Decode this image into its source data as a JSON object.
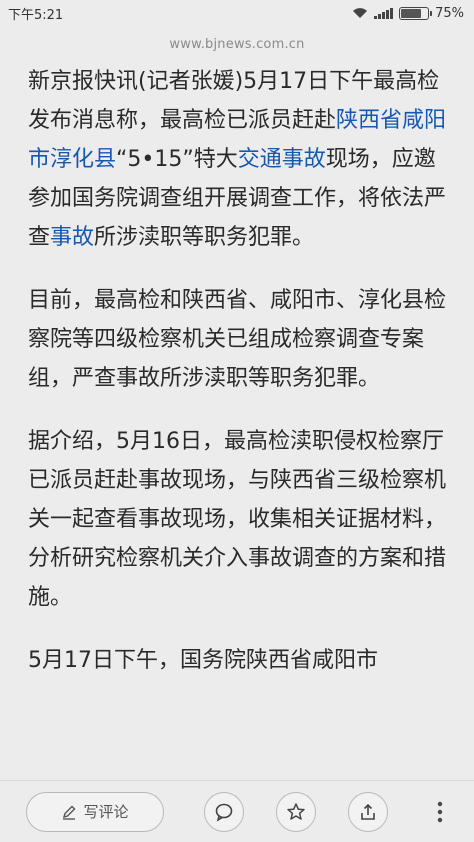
{
  "status_bar": {
    "time": "下午5:21",
    "battery": "75%",
    "battery_level": 0.75
  },
  "url_bar": {
    "url": "www.bjnews.com.cn"
  },
  "article": {
    "p1": {
      "t1": "新京报快讯(记者张媛)5月17日下午最高检发布消息称，最高检已派员赶赴",
      "link1": "陕西省咸阳市淳化县",
      "t2": "“5•15”特大",
      "link2": "交通事故",
      "t3": "现场，应邀参加国务院调查组开展调查工作，将依法严查",
      "link3": "事故",
      "t4": "所涉渎职等职务犯罪。"
    },
    "p2": "目前，最高检和陕西省、咸阳市、淳化县检察院等四级检察机关已组成检察调查专案组，严查事故所涉渎职等职务犯罪。",
    "p3": "据介绍，5月16日，最高检渎职侵权检察厅已派员赶赴事故现场，与陕西省三级检察机关一起查看事故现场，收集相关证据材料，分析研究检察机关介入事故调查的方案和措施。",
    "p4": "5月17日下午，国务院陕西省咸阳市"
  },
  "toolbar": {
    "write_comment_label": "写评论",
    "icons": [
      "edit-icon",
      "comment-icon",
      "star-icon",
      "share-icon",
      "more-icon"
    ]
  }
}
